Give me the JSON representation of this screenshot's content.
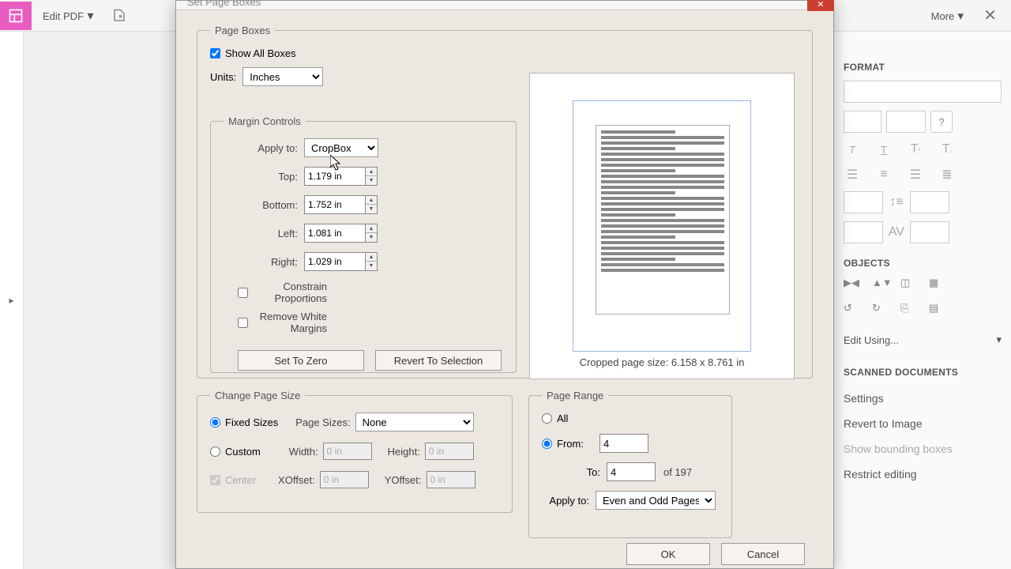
{
  "toolbar": {
    "edit_pdf": "Edit PDF",
    "more": "More"
  },
  "dialog": {
    "title": "Set Page Boxes",
    "page_boxes_legend": "Page Boxes",
    "show_all": "Show All Boxes",
    "units_label": "Units:",
    "units_value": "Inches",
    "margin_legend": "Margin Controls",
    "apply_to_label": "Apply to:",
    "apply_to_value": "CropBox",
    "top_label": "Top:",
    "top_value": "1.179 in",
    "bottom_label": "Bottom:",
    "bottom_value": "1.752 in",
    "left_label": "Left:",
    "left_value": "1.081 in",
    "right_label": "Right:",
    "right_value": "1.029 in",
    "constrain": "Constrain Proportions",
    "remove_white": "Remove White Margins",
    "set_zero": "Set To Zero",
    "revert": "Revert To Selection",
    "cropped_size": "Cropped page size: 6.158 x 8.761 in",
    "change_legend": "Change Page Size",
    "fixed_sizes": "Fixed Sizes",
    "custom": "Custom",
    "center": "Center",
    "page_sizes_label": "Page Sizes:",
    "page_sizes_value": "None",
    "width_label": "Width:",
    "height_label": "Height:",
    "xoffset_label": "XOffset:",
    "yoffset_label": "YOffset:",
    "zero_in": "0 in",
    "pagerange_legend": "Page Range",
    "all": "All",
    "from_label": "From:",
    "from_value": "4",
    "to_label": "To:",
    "to_value": "4",
    "of_total": "of 197",
    "range_apply_label": "Apply to:",
    "range_apply_value": "Even and Odd Pages",
    "ok": "OK",
    "cancel": "Cancel"
  },
  "panel": {
    "format_title": "FORMAT",
    "objects_title": "OBJECTS",
    "scanned_title": "SCANNED DOCUMENTS",
    "edit_using": "Edit Using...",
    "settings": "Settings",
    "revert_image": "Revert to Image",
    "show_bounding": "Show bounding boxes",
    "restrict": "Restrict editing"
  }
}
